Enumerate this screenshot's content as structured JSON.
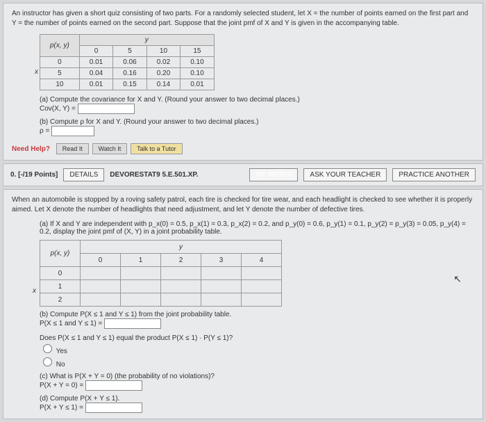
{
  "q1": {
    "intro": "An instructor has given a short quiz consisting of two parts. For a randomly selected student, let X = the number of points earned on the first part and Y = the number of points earned on the second part. Suppose that the joint pmf of X and Y is given in the accompanying table.",
    "tbl": {
      "corner": "p(x, y)",
      "yhead": "y",
      "ycols": [
        "0",
        "5",
        "10",
        "15"
      ],
      "xside": "x",
      "xrows": [
        "0",
        "5",
        "10"
      ],
      "r0": [
        "0.01",
        "0.06",
        "0.02",
        "0.10"
      ],
      "r1": [
        "0.04",
        "0.16",
        "0.20",
        "0.10"
      ],
      "r2": [
        "0.01",
        "0.15",
        "0.14",
        "0.01"
      ]
    },
    "a": "(a) Compute the covariance for X and Y. (Round your answer to two decimal places.)",
    "a_lbl": "Cov(X, Y) =",
    "b": "(b) Compute ρ for X and Y. (Round your answer to two decimal places.)",
    "b_lbl": "ρ =",
    "needhelp": "Need Help?",
    "read": "Read It",
    "watch": "Watch It",
    "talk": "Talk to a Tutor"
  },
  "hdr": {
    "pts": "0. [-/19 Points]",
    "details": "DETAILS",
    "ref": "DEVORESTAT9 5.E.501.XP.",
    "mynotes": "MY NOTES",
    "ask": "ASK YOUR TEACHER",
    "practice": "PRACTICE ANOTHER"
  },
  "q2": {
    "intro": "When an automobile is stopped by a roving safety patrol, each tire is checked for tire wear, and each headlight is checked to see whether it is properly aimed. Let X denote the number of headlights that need adjustment, and let Y denote the number of defective tires.",
    "a": "(a) If X and Y are independent with p_x(0) = 0.5, p_x(1) = 0.3, p_x(2) = 0.2, and p_y(0) = 0.6, p_y(1) = 0.1, p_y(2) = p_y(3) = 0.05, p_y(4) = 0.2, display the joint pmf of (X, Y) in a joint probability table.",
    "tbl": {
      "corner": "p(x, y)",
      "ycols": [
        "0",
        "1",
        "2",
        "3",
        "4"
      ],
      "xside": "x",
      "xrows": [
        "0",
        "1",
        "2"
      ],
      "yhead": "y"
    },
    "b": "(b) Compute P(X ≤ 1 and Y ≤ 1) from the joint probability table.",
    "b_lbl": "P(X ≤ 1 and Y ≤ 1) =",
    "b2": "Does P(X ≤ 1 and Y ≤ 1) equal the product P(X ≤ 1) · P(Y ≤ 1)?",
    "yes": "Yes",
    "no": "No",
    "c": "(c) What is P(X + Y = 0) (the probability of no violations)?",
    "c_lbl": "P(X + Y = 0) =",
    "d": "(d) Compute P(X + Y ≤ 1).",
    "d_lbl": "P(X + Y ≤ 1) ="
  }
}
